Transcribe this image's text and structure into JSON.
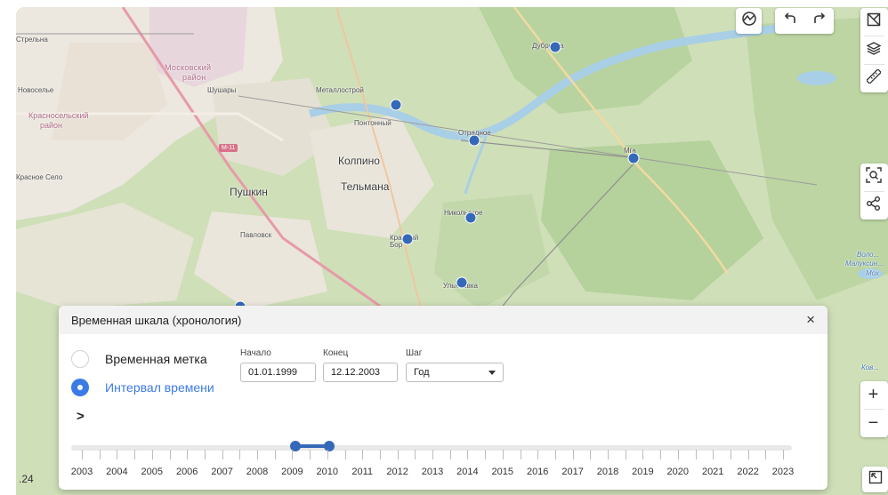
{
  "map": {
    "places": {
      "strelna": "Стрельна",
      "moskovsky_1": "Московский",
      "moskovsky_2": "район",
      "novoselye": "Новоселье",
      "shushary": "Шушары",
      "metallostroy": "Металлострой",
      "krasnoselsky_1": "Красносельский",
      "krasnoselsky_2": "район",
      "pontonny": "Понтонный",
      "otradnoe": "Отрадное",
      "dubrovka": "Дубровка",
      "mga": "Мга",
      "m11": "M-11",
      "kolpino": "Колпино",
      "krasnoe_selo": "Красное Село",
      "pushkin": "Пушкин",
      "telmana": "Тельмана",
      "nikolskoe": "Никольское",
      "pavlovsk": "Павловск",
      "krasny_bor": "Красный Бор",
      "ulyanovka": "Ульяновка",
      "right_1": "Воло...",
      "right_2": "Малуксин...",
      "right_3": "Мох",
      "right_4": "Ков..."
    },
    "scale_text": ".24"
  },
  "controls": {
    "top": [
      "analytics-icon",
      "undo-icon",
      "redo-icon"
    ],
    "right": [
      "map-select-icon",
      "layers-icon",
      "ruler-icon",
      "search-area-icon",
      "share-icon",
      "zoom-in-icon",
      "zoom-out-icon",
      "fullscreen-icon"
    ],
    "zoom_in": "+",
    "zoom_out": "−"
  },
  "timeline": {
    "title": "Временная шкала (хронология)",
    "close": "×",
    "mode_point": "Временная метка",
    "mode_interval": "Интервал времени",
    "selected_mode": "interval",
    "start_label": "Начало",
    "start_value": "01.01.1999",
    "end_label": "Конец",
    "end_value": "12.12.2003",
    "step_label": "Шаг",
    "step_value": "Год",
    "expand": ">",
    "years": [
      "2003",
      "2004",
      "2005",
      "2006",
      "2007",
      "2008",
      "2009",
      "2010",
      "2011",
      "2012",
      "2013",
      "2014",
      "2015",
      "2016",
      "2017",
      "2018",
      "2019",
      "2020",
      "2021",
      "2022",
      "2023"
    ],
    "range": [
      "2009",
      "2010"
    ],
    "accent": "#3569b8",
    "radio_color": "#3b7be6"
  }
}
